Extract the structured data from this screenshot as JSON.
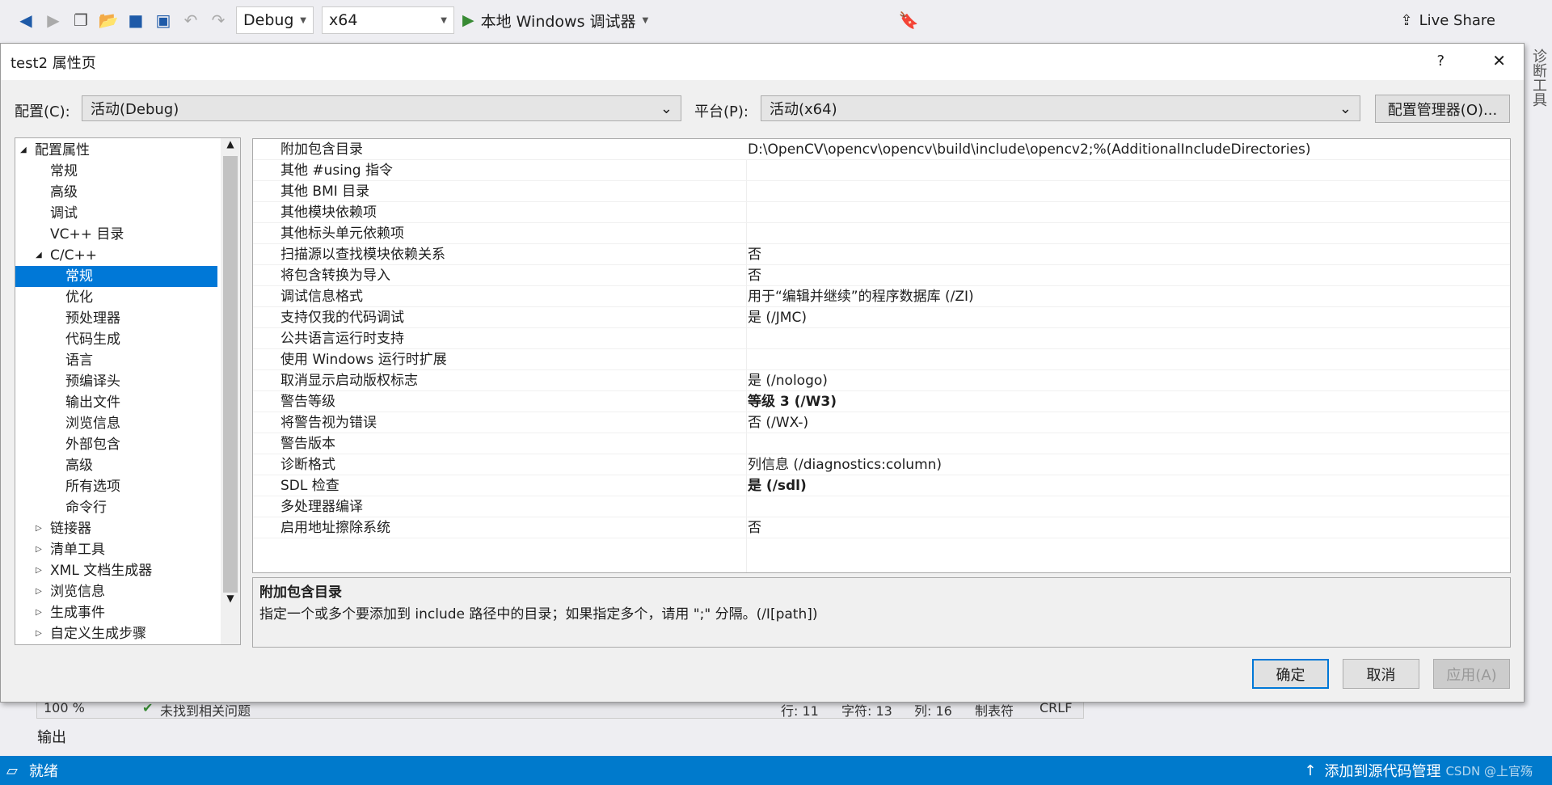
{
  "toolbar": {
    "config": "Debug",
    "platform": "x64",
    "run_label": "本地 Windows 调试器",
    "live_share": "Live Share"
  },
  "dialog": {
    "title": "test2 属性页",
    "help": "?",
    "close": "✕",
    "config_label": "配置(C):",
    "config_value": "活动(Debug)",
    "platform_label": "平台(P):",
    "platform_value": "活动(x64)",
    "config_manager": "配置管理器(O)...",
    "tree": [
      {
        "label": "配置属性",
        "level": 0,
        "expander": "◢"
      },
      {
        "label": "常规",
        "level": 1
      },
      {
        "label": "高级",
        "level": 1
      },
      {
        "label": "调试",
        "level": 1
      },
      {
        "label": "VC++ 目录",
        "level": 1
      },
      {
        "label": "C/C++",
        "level": 1,
        "expander": "◢"
      },
      {
        "label": "常规",
        "level": 2,
        "selected": true
      },
      {
        "label": "优化",
        "level": 2
      },
      {
        "label": "预处理器",
        "level": 2
      },
      {
        "label": "代码生成",
        "level": 2
      },
      {
        "label": "语言",
        "level": 2
      },
      {
        "label": "预编译头",
        "level": 2
      },
      {
        "label": "输出文件",
        "level": 2
      },
      {
        "label": "浏览信息",
        "level": 2
      },
      {
        "label": "外部包含",
        "level": 2
      },
      {
        "label": "高级",
        "level": 2
      },
      {
        "label": "所有选项",
        "level": 2
      },
      {
        "label": "命令行",
        "level": 2
      },
      {
        "label": "链接器",
        "level": 1,
        "expander": "▷"
      },
      {
        "label": "清单工具",
        "level": 1,
        "expander": "▷"
      },
      {
        "label": "XML 文档生成器",
        "level": 1,
        "expander": "▷"
      },
      {
        "label": "浏览信息",
        "level": 1,
        "expander": "▷"
      },
      {
        "label": "生成事件",
        "level": 1,
        "expander": "▷"
      },
      {
        "label": "自定义生成步骤",
        "level": 1,
        "expander": "▷"
      }
    ],
    "properties": [
      {
        "name": "附加包含目录",
        "value": "D:\\OpenCV\\opencv\\opencv\\build\\include\\opencv2;%(AdditionalIncludeDirectories)"
      },
      {
        "name": "其他 #using 指令",
        "value": ""
      },
      {
        "name": "其他 BMI 目录",
        "value": ""
      },
      {
        "name": "其他模块依赖项",
        "value": ""
      },
      {
        "name": "其他标头单元依赖项",
        "value": ""
      },
      {
        "name": "扫描源以查找模块依赖关系",
        "value": "否"
      },
      {
        "name": "将包含转换为导入",
        "value": "否"
      },
      {
        "name": "调试信息格式",
        "value": "用于“编辑并继续”的程序数据库 (/ZI)"
      },
      {
        "name": "支持仅我的代码调试",
        "value": "是 (/JMC)"
      },
      {
        "name": "公共语言运行时支持",
        "value": ""
      },
      {
        "name": "使用 Windows 运行时扩展",
        "value": ""
      },
      {
        "name": "取消显示启动版权标志",
        "value": "是 (/nologo)"
      },
      {
        "name": "警告等级",
        "value": "等级 3 (/W3)",
        "bold": true
      },
      {
        "name": "将警告视为错误",
        "value": "否 (/WX-)"
      },
      {
        "name": "警告版本",
        "value": ""
      },
      {
        "name": "诊断格式",
        "value": "列信息 (/diagnostics:column)"
      },
      {
        "name": "SDL 检查",
        "value": "是 (/sdl)",
        "bold": true
      },
      {
        "name": "多处理器编译",
        "value": ""
      },
      {
        "name": "启用地址擦除系统",
        "value": "否"
      }
    ],
    "desc_title": "附加包含目录",
    "desc_text": "指定一个或多个要添加到 include 路径中的目录；如果指定多个，请用 \";\" 分隔。(/I[path])",
    "ok": "确定",
    "cancel": "取消",
    "apply": "应用(A)"
  },
  "background": {
    "zoom": "100 %",
    "issues": "未找到相关问题",
    "line": "行: 11",
    "char": "字符: 13",
    "col": "列: 16",
    "tabs": "制表符",
    "eol": "CRLF",
    "output": "输出",
    "side_tab": "诊断工具"
  },
  "statusbar": {
    "ready": "就绪",
    "source_control": "添加到源代码管理",
    "watermark": "CSDN @上官殇"
  },
  "colors": {
    "accent": "#0078d7",
    "statusbar": "#007acc"
  }
}
